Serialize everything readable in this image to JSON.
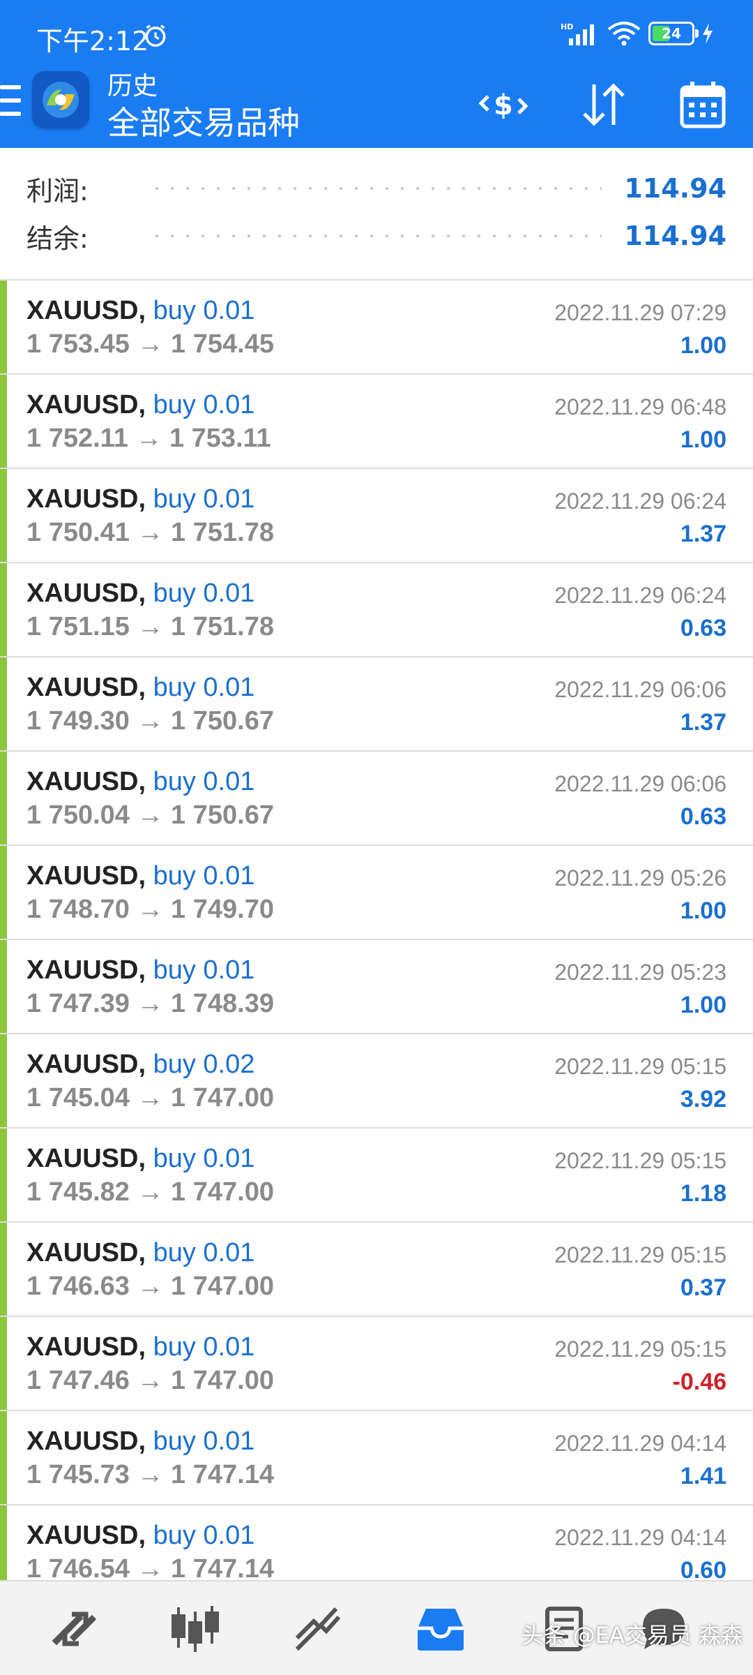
{
  "status_bar": {
    "time": "下午2:12",
    "battery": "24"
  },
  "header": {
    "subtitle": "历史",
    "title": "全部交易品种"
  },
  "summary": {
    "profit_label": "利润:",
    "profit_value": "114.94",
    "balance_label": "结余:",
    "balance_value": "114.94"
  },
  "trades": [
    {
      "symbol": "XAUUSD,",
      "side": "buy 0.01",
      "open": "1 753.45",
      "close": "1 754.45",
      "time": "2022.11.29 07:29",
      "profit": "1.00"
    },
    {
      "symbol": "XAUUSD,",
      "side": "buy 0.01",
      "open": "1 752.11",
      "close": "1 753.11",
      "time": "2022.11.29 06:48",
      "profit": "1.00"
    },
    {
      "symbol": "XAUUSD,",
      "side": "buy 0.01",
      "open": "1 750.41",
      "close": "1 751.78",
      "time": "2022.11.29 06:24",
      "profit": "1.37"
    },
    {
      "symbol": "XAUUSD,",
      "side": "buy 0.01",
      "open": "1 751.15",
      "close": "1 751.78",
      "time": "2022.11.29 06:24",
      "profit": "0.63"
    },
    {
      "symbol": "XAUUSD,",
      "side": "buy 0.01",
      "open": "1 749.30",
      "close": "1 750.67",
      "time": "2022.11.29 06:06",
      "profit": "1.37"
    },
    {
      "symbol": "XAUUSD,",
      "side": "buy 0.01",
      "open": "1 750.04",
      "close": "1 750.67",
      "time": "2022.11.29 06:06",
      "profit": "0.63"
    },
    {
      "symbol": "XAUUSD,",
      "side": "buy 0.01",
      "open": "1 748.70",
      "close": "1 749.70",
      "time": "2022.11.29 05:26",
      "profit": "1.00"
    },
    {
      "symbol": "XAUUSD,",
      "side": "buy 0.01",
      "open": "1 747.39",
      "close": "1 748.39",
      "time": "2022.11.29 05:23",
      "profit": "1.00"
    },
    {
      "symbol": "XAUUSD,",
      "side": "buy 0.02",
      "open": "1 745.04",
      "close": "1 747.00",
      "time": "2022.11.29 05:15",
      "profit": "3.92"
    },
    {
      "symbol": "XAUUSD,",
      "side": "buy 0.01",
      "open": "1 745.82",
      "close": "1 747.00",
      "time": "2022.11.29 05:15",
      "profit": "1.18"
    },
    {
      "symbol": "XAUUSD,",
      "side": "buy 0.01",
      "open": "1 746.63",
      "close": "1 747.00",
      "time": "2022.11.29 05:15",
      "profit": "0.37"
    },
    {
      "symbol": "XAUUSD,",
      "side": "buy 0.01",
      "open": "1 747.46",
      "close": "1 747.00",
      "time": "2022.11.29 05:15",
      "profit": "-0.46"
    },
    {
      "symbol": "XAUUSD,",
      "side": "buy 0.01",
      "open": "1 745.73",
      "close": "1 747.14",
      "time": "2022.11.29 04:14",
      "profit": "1.41"
    },
    {
      "symbol": "XAUUSD,",
      "side": "buy 0.01",
      "open": "1 746.54",
      "close": "1 747.14",
      "time": "2022.11.29 04:14",
      "profit": "0.60"
    }
  ],
  "colors": {
    "header_bg": "#1a7cf2",
    "accent_blue": "#1a6fd0",
    "loss_red": "#d0202a",
    "trade_bar_green": "#8cc63f"
  },
  "bottom_nav": {
    "items": [
      "quotes-icon",
      "chart-icon",
      "trade-icon",
      "history-icon",
      "news-icon",
      "messages-icon"
    ],
    "active": "history-icon"
  },
  "watermark": "头条 @EA交易员 森森"
}
